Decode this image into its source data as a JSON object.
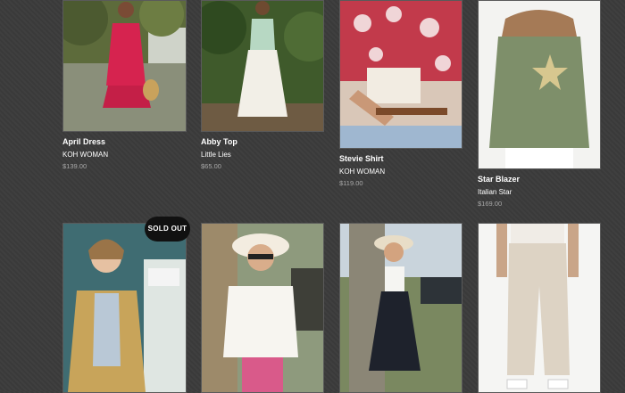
{
  "products": [
    {
      "name": "April Dress",
      "brand": "KOH WOMAN",
      "price": "$139.00"
    },
    {
      "name": "Abby Top",
      "brand": "Little Lies",
      "price": "$65.00"
    },
    {
      "name": "Stevie Shirt",
      "brand": "KOH WOMAN",
      "price": "$119.00"
    },
    {
      "name": "Star Blazer",
      "brand": "Italian Star",
      "price": "$169.00"
    }
  ],
  "badge": {
    "sold_out": "SOLD OUT"
  },
  "colors": {
    "background": "#3b3b3b",
    "title": "#ffffff",
    "price": "#a9a9a9",
    "badge_bg": "#111111"
  }
}
